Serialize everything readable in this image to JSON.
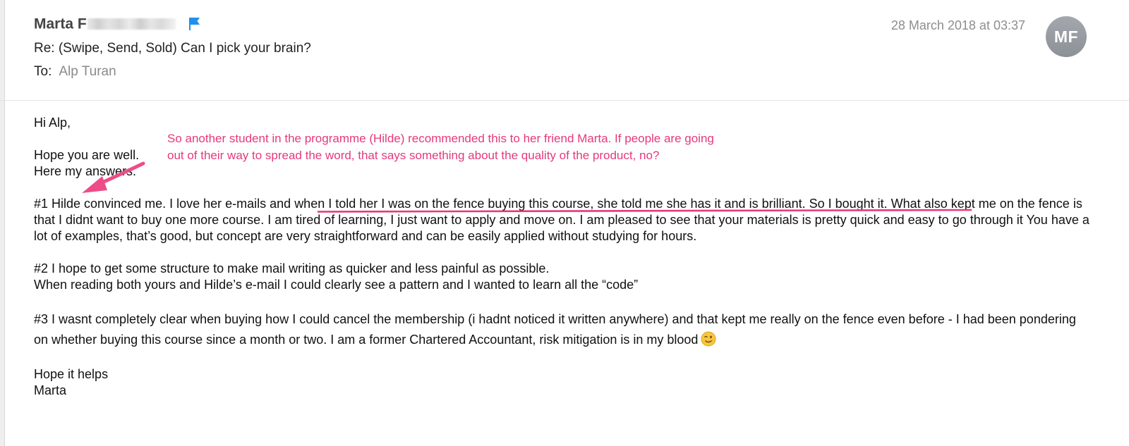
{
  "email": {
    "sender_name": "Marta F",
    "date": "28 March 2018 at 03:37",
    "subject": "Re: (Swipe, Send, Sold) Can I pick your brain?",
    "to_label": "To:",
    "to_value": "Alp Turan",
    "avatar_initials": "MF"
  },
  "colors": {
    "annotation": "#e5397a",
    "flag": "#1f8ff0",
    "avatar": "#9a9ea4"
  },
  "body": {
    "greeting": "Hi Alp,",
    "line1": "Hope you are well.",
    "line2": "Here my answers.",
    "q1_before": "#1 Hilde convinced me. I love her e-mails and ",
    "q1_highlight": "when I told her I was on the fence buying this course, she told me she has it and is brilliant. So I bought it.",
    "q1_after": " What also kept me on the fence is that I didnt want to buy one more course. I am tired of learning, I just want to apply and move on. I am pleased to see that your materials is pretty quick and easy to go through it You have a lot of examples, that’s good, but concept are very straightforward and can be easily applied without studying for hours.",
    "q2_line1": "#2 I hope to get some structure to make mail writing as quicker and less painful as possible.",
    "q2_line2": "When reading both yours and Hilde’s e-mail I could clearly see a pattern and I wanted to learn all the “code”",
    "q3": "#3 I wasnt completely clear when buying how I could cancel the membership (i hadnt noticed it written anywhere) and that kept me really on the fence even before - I had been pondering on whether buying this course since a month or two. I am a former Chartered Accountant, risk mitigation is in my blood",
    "sign_off": "Hope it helps",
    "signature": "Marta"
  },
  "annotation": {
    "line1": "So another student in the programme (Hilde) recommended this to her friend Marta. If people are going",
    "line2": "out of their way to spread the word, that says something about the quality of the product, no?"
  },
  "icons": {
    "flag": "flag-icon",
    "emoji": "winking-face-icon",
    "arrow": "pink-arrow-icon"
  }
}
